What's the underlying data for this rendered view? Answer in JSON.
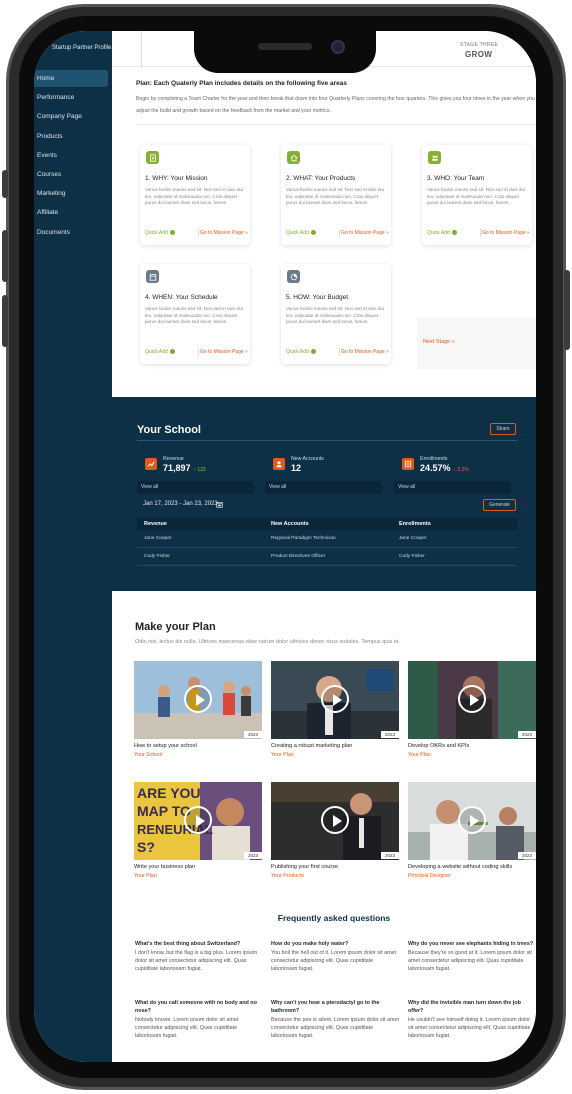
{
  "sidebar": {
    "profile": "Startup Partner Profile",
    "items": [
      "Home",
      "Performance",
      "Company Page",
      "Products",
      "Events",
      "Courses",
      "Marketing",
      "Affiliate",
      "Documents"
    ]
  },
  "header": {
    "stage_label": "STAGE THREE",
    "stage_name": "GROW"
  },
  "plan": {
    "title": "Plan: Each Quaterly Plan includes details on the following five areas",
    "description": "Begin by completing a Team Charter for the year and then break that down into four Quarterly Plans covering the four quarters. This gives you four times in the year when you adjust the build and growth based on the feedback from the market and your metrics.",
    "cards": [
      {
        "title": "1. WHY: Your Mission",
        "text": "Varius facilisi mauris sed sit. Non sed et duis dui leo, vulputate id malesuada non. Cras aliquet purus dui laoreet diam sed lacus, fames.",
        "quick_add": "Quick Add",
        "link": "Go to Mission Page »",
        "icon": "document-icon",
        "color": "#86b032"
      },
      {
        "title": "2. WHAT: Your Products",
        "text": "Varius facilisi mauris sed sit. Non sed et duis dui leo, vulputate id malesuada non. Cras aliquet purus dui laoreet diam sed lacus, fames.",
        "quick_add": "Quick Add",
        "link": "Go to Mission Page »",
        "icon": "home-icon",
        "color": "#86b032"
      },
      {
        "title": "3. WHO: Your Team",
        "text": "Varius facilisi mauris sed sit. Non sed et duis dui leo, vulputate id malesuada non. Cras aliquet purus dui laoreet diam sed lacus, fames.",
        "quick_add": "Quick Add",
        "link": "Go to Mission Page »",
        "icon": "team-icon",
        "color": "#86b032"
      },
      {
        "title": "4. WHEN: Your Schedule",
        "text": "Varius facilisi mauris sed sit. Non sed et duis dui leo, vulputate id malesuada non. Cras aliquet purus dui laoreet diam sed lacus, fames.",
        "quick_add": "Quick Add",
        "link": "Go to Mission Page »",
        "icon": "calendar-icon",
        "color": "#6c7a89"
      },
      {
        "title": "5. HOW: Your Budget",
        "text": "Varius facilisi mauris sed sit. Non sed et duis dui leo, vulputate id malesuada non. Cras aliquet purus dui laoreet diam sed lacus, fames.",
        "quick_add": "Quick Add",
        "link": "Go to Mission Page »",
        "icon": "budget-icon",
        "color": "#6c7a89"
      }
    ],
    "next_stage": "Next Stage »"
  },
  "school": {
    "title": "Your School",
    "share": "Share",
    "stats": [
      {
        "label": "Revenue",
        "value": "71,897",
        "change": "↑ 122",
        "change_color": "#7cd34a",
        "view_all": "View all"
      },
      {
        "label": "New Accounts",
        "value": "12",
        "change": "",
        "change_color": "#7cd34a",
        "view_all": "View all"
      },
      {
        "label": "Enrollments",
        "value": "24.57%",
        "change": "↓ 3.2%",
        "change_color": "#ff5a3c",
        "view_all": "View all"
      }
    ],
    "date_range": "Jan 17, 2023 - Jan 23, 2023",
    "generate": "Generate",
    "table": {
      "headers": [
        "Revenue",
        "New Accounts",
        "Enrollments"
      ],
      "rows": [
        [
          "Jane Cooper",
          "Regional Paradigm Technician",
          "Jane Cooper"
        ],
        [
          "Cody Fisher",
          "Product Directives Officer",
          "Cody Fisher"
        ]
      ]
    }
  },
  "make_plan": {
    "title": "Make your Plan",
    "description": "Odio nisi, lectus dis nulla. Ultrices maecenas vitae rutrum dolor ultricies donec risus sodales. Tempus quis et.",
    "videos": [
      {
        "title": "How to setup your school",
        "category": "Your School",
        "year": "2023"
      },
      {
        "title": "Creating a robust marketing plan",
        "category": "Your Plan",
        "year": "2023"
      },
      {
        "title": "Develop OKRs and KPIs",
        "category": "Your Plan",
        "year": "2023"
      },
      {
        "title": "Write your business plan",
        "category": "Your Plan",
        "year": "2023"
      },
      {
        "title": "Publishing your first course",
        "category": "Your Products",
        "year": "2023"
      },
      {
        "title": "Developing a website without coding skills",
        "category": "Principal Designer",
        "year": "2023"
      }
    ],
    "poster_text": "ARE YOU MAP TO RENEURIAL S?"
  },
  "faq": {
    "title": "Frequently asked questions",
    "items": [
      {
        "q": "What's the best thing about Switzerland?",
        "a": "I don't know, but the flag is a big plus. Lorem ipsum dolor sit amet consectetur adipiscing elit. Quas cupiditate laboriosam fugiat."
      },
      {
        "q": "How do you make holy water?",
        "a": "You boil the hell out of it. Lorem ipsum dolor sit amet consectetur adipiscing elit. Quas cupiditate laboriosam fugiat."
      },
      {
        "q": "Why do you never see elephants hiding in trees?",
        "a": "Because they're so good at it. Lorem ipsum dolor sit amet consectetur adipiscing elit. Quas cupiditate laboriosam fugiat."
      },
      {
        "q": "What do you call someone with no body and no nose?",
        "a": "Nobody knows. Lorem ipsum dolor sit amet consectetur adipiscing elit. Quas cupiditate laboriosam fugiat."
      },
      {
        "q": "Why can't you hear a pterodactyl go to the bathroom?",
        "a": "Because the pee is silent. Lorem ipsum dolor sit amet consectetur adipiscing elit. Quas cupiditate laboriosam fugiat."
      },
      {
        "q": "Why did the invisible man turn down the job offer?",
        "a": "He couldn't see himself doing it. Lorem ipsum dolor sit amet consectetur adipiscing elit. Quas cupiditate laboriosam fugiat."
      }
    ]
  },
  "colors": {
    "navy": "#0d3047",
    "accent_orange": "#e05a1a",
    "accent_green": "#86b032"
  }
}
